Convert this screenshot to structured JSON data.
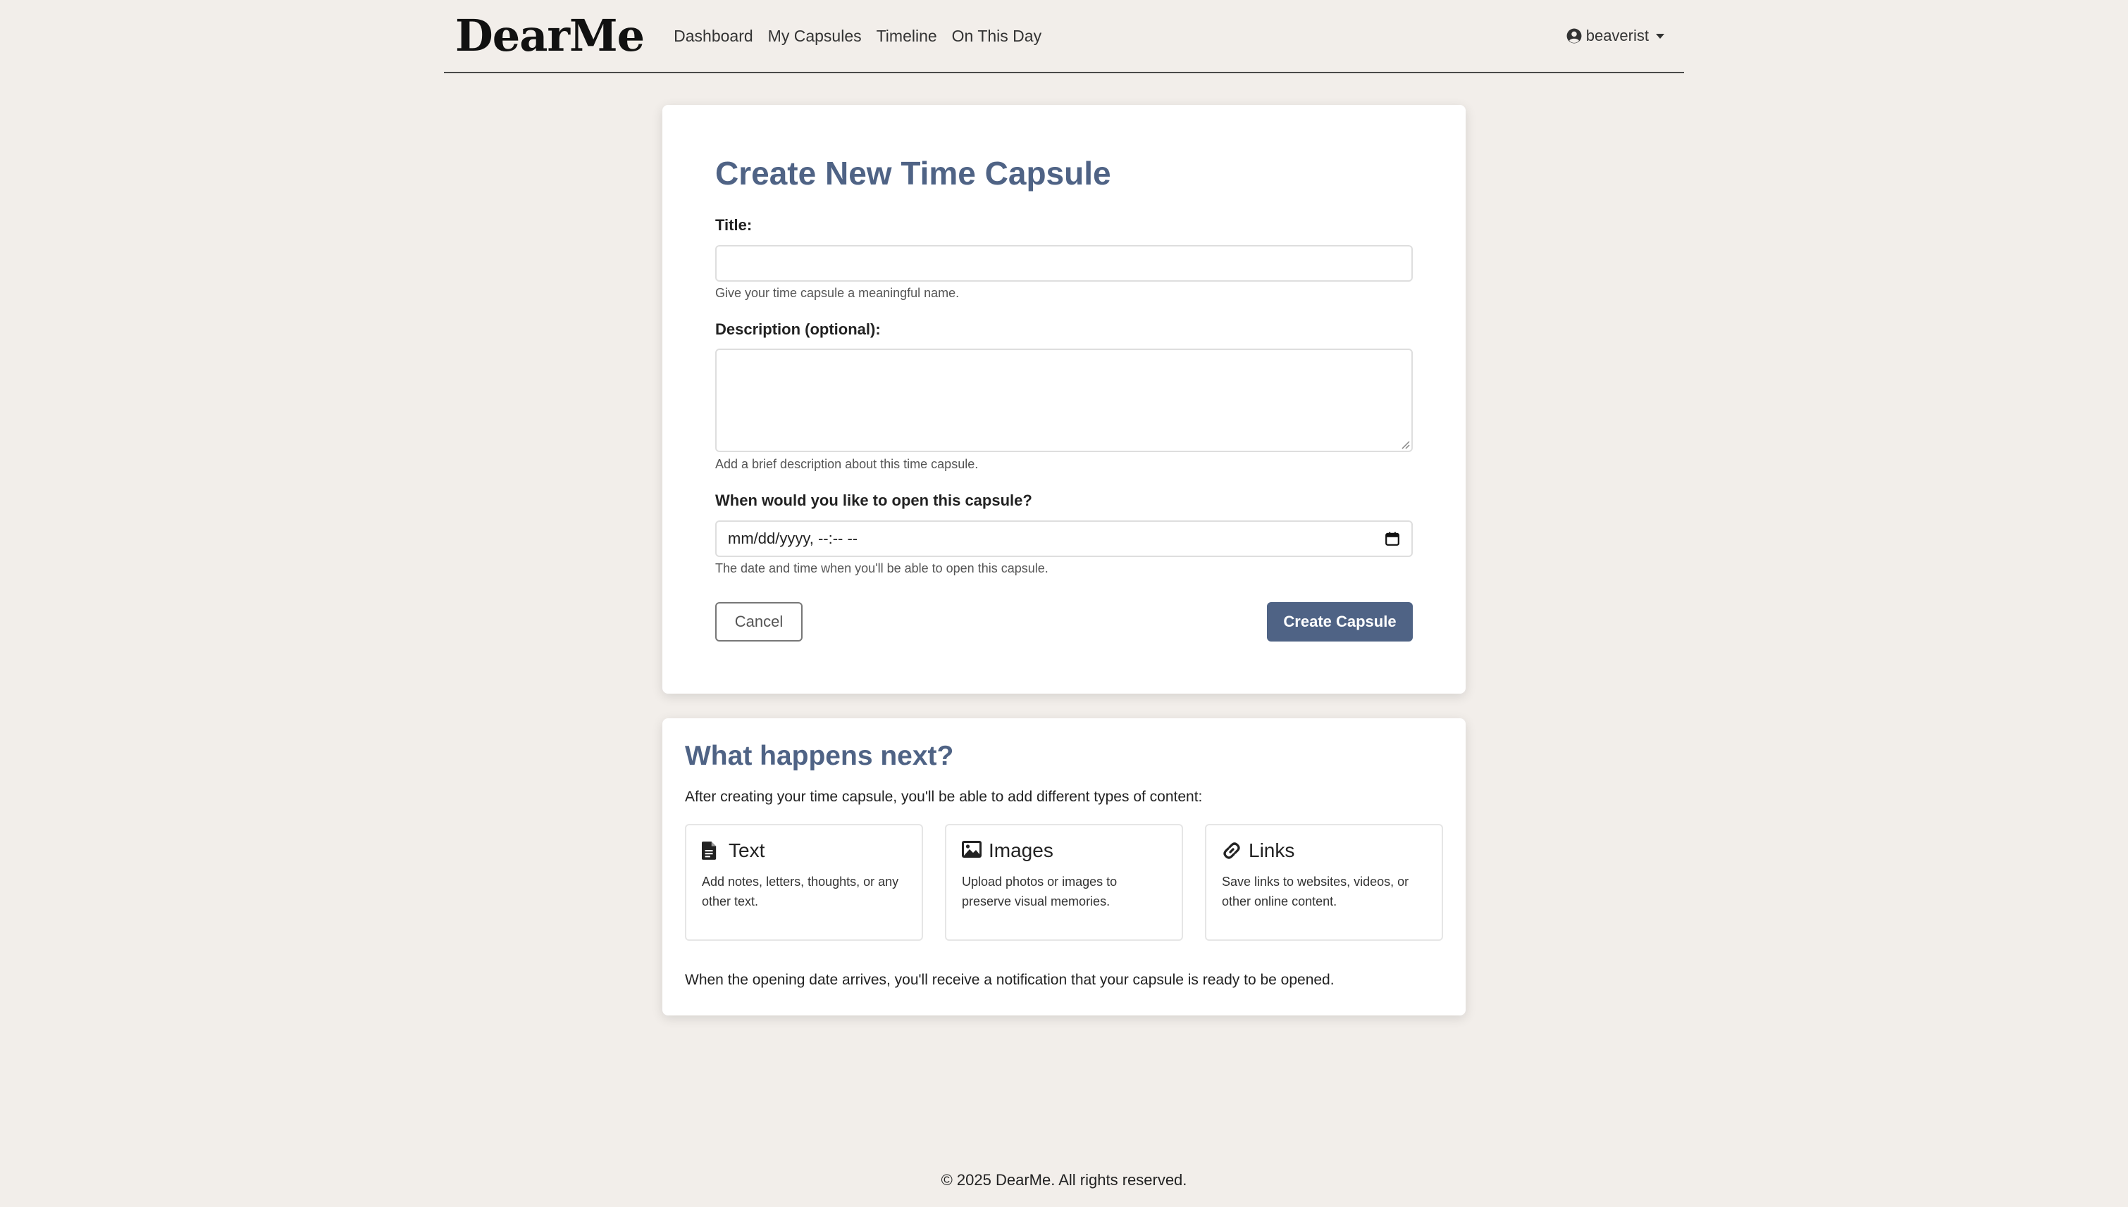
{
  "brand": "DearMe",
  "nav": {
    "links": [
      "Dashboard",
      "My Capsules",
      "Timeline",
      "On This Day"
    ],
    "user": "beaverist"
  },
  "form": {
    "title": "Create New Time Capsule",
    "title_label": "Title:",
    "title_value": "",
    "title_help": "Give your time capsule a meaningful name.",
    "description_label": "Description (optional):",
    "description_value": "",
    "description_help": "Add a brief description about this time capsule.",
    "date_label": "When would you like to open this capsule?",
    "date_placeholder": "mm/dd/yyyy, --:-- --",
    "date_help": "The date and time when you'll be able to open this capsule.",
    "cancel_label": "Cancel",
    "submit_label": "Create Capsule"
  },
  "info": {
    "title": "What happens next?",
    "intro": "After creating your time capsule, you'll be able to add different types of content:",
    "types": [
      {
        "icon": "file-text-icon",
        "title": "Text",
        "description": "Add notes, letters, thoughts, or any other text."
      },
      {
        "icon": "image-icon",
        "title": "Images",
        "description": "Upload photos or images to preserve visual memories."
      },
      {
        "icon": "link-icon",
        "title": "Links",
        "description": "Save links to websites, videos, or other online content."
      }
    ],
    "footer": "When the opening date arrives, you'll receive a notification that your capsule is ready to be opened."
  },
  "copyright": "© 2025 DearMe. All rights reserved.",
  "colors": {
    "background": "#f2eeea",
    "accent": "#4f6385",
    "card": "#ffffff"
  }
}
